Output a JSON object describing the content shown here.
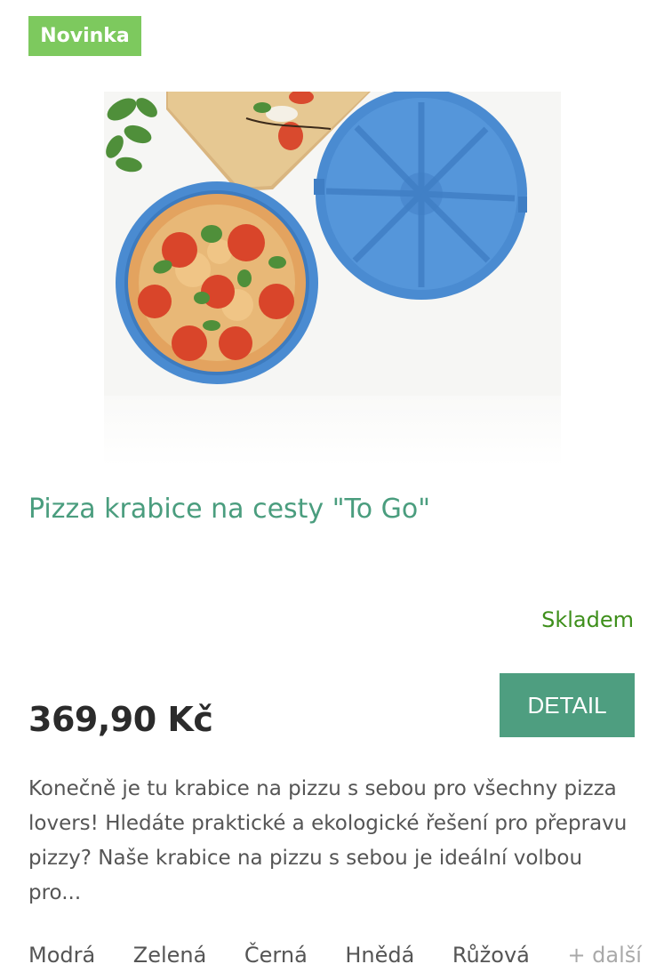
{
  "badge": {
    "label": "Novinka",
    "color": "#7dc95e"
  },
  "product": {
    "title": "Pizza krabice na cesty \"To Go\"",
    "stock": "Skladem",
    "price": "369,90 Kč",
    "detail_label": "DETAIL",
    "description": "Konečně je tu krabice na pizzu s sebou pro všechny pizza lovers! Hledáte praktické a ekologické řešení pro přepravu pizzy? Naše krabice na pizzu s sebou je ideální volbou pro...",
    "image_icon": "product-photo"
  },
  "variants": {
    "items": [
      "Modrá",
      "Zelená",
      "Černá",
      "Hnědá",
      "Růžová"
    ],
    "more_label": "+ další"
  },
  "colors": {
    "accent": "#4e9e80",
    "title": "#4a9d7e",
    "stock": "#3e8f1b",
    "price": "#2b2b2b"
  }
}
